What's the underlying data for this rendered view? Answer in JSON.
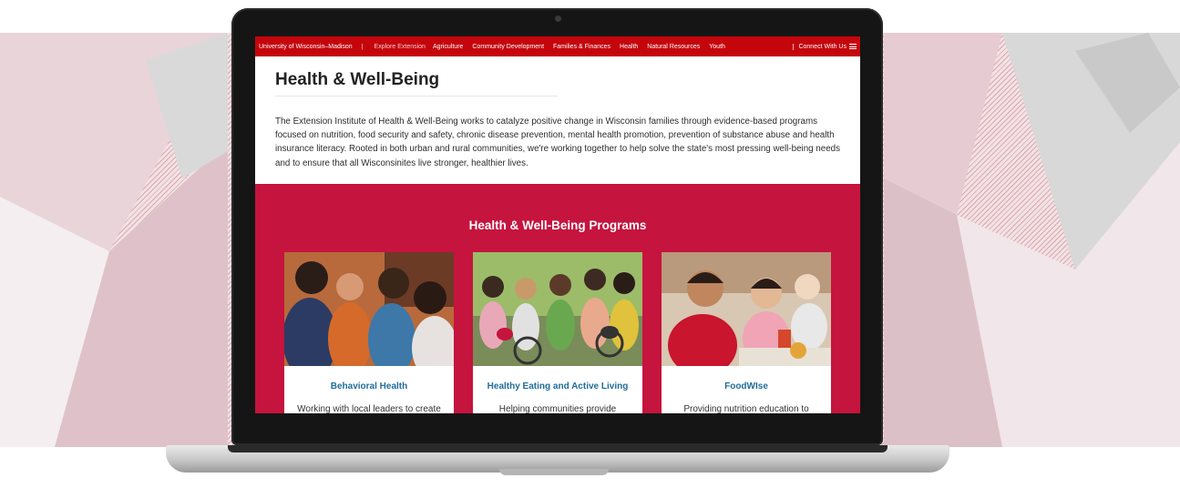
{
  "nav": {
    "site_name": "University of Wisconsin–Madison",
    "separator": "|",
    "explore_label": "Explore Extension",
    "links": [
      "Agriculture",
      "Community Development",
      "Families & Finances",
      "Health",
      "Natural Resources",
      "Youth"
    ],
    "connect_label": "Connect With Us",
    "menu_icon": "hamburger-menu-icon"
  },
  "page": {
    "title": "Health & Well-Being",
    "intro": "The Extension Institute of Health & Well-Being works to catalyze positive change in Wisconsin families through evidence-based programs focused on nutrition, food security and safety, chronic disease prevention, mental health promotion, prevention of substance abuse and health insurance literacy. Rooted in both urban and rural communities, we're working together to help solve the state's most pressing well-being needs and to ensure that all Wisconsinites live stronger, healthier lives."
  },
  "programs": {
    "heading": "Health & Well-Being Programs",
    "cards": [
      {
        "title": "Behavioral Health",
        "text": "Working with local leaders to create",
        "photo": "group-of-teens-laughing-photo"
      },
      {
        "title": "Healthy Eating and Active Living",
        "text": "Helping communities provide",
        "photo": "kids-with-bicycles-photo"
      },
      {
        "title": "FoodWIse",
        "text": "Providing nutrition education to",
        "photo": "children-eating-lunch-photo"
      }
    ]
  },
  "colors": {
    "brand_red": "#c5050c",
    "programs_band": "#c5143e",
    "card_title": "#1f6d9a"
  }
}
